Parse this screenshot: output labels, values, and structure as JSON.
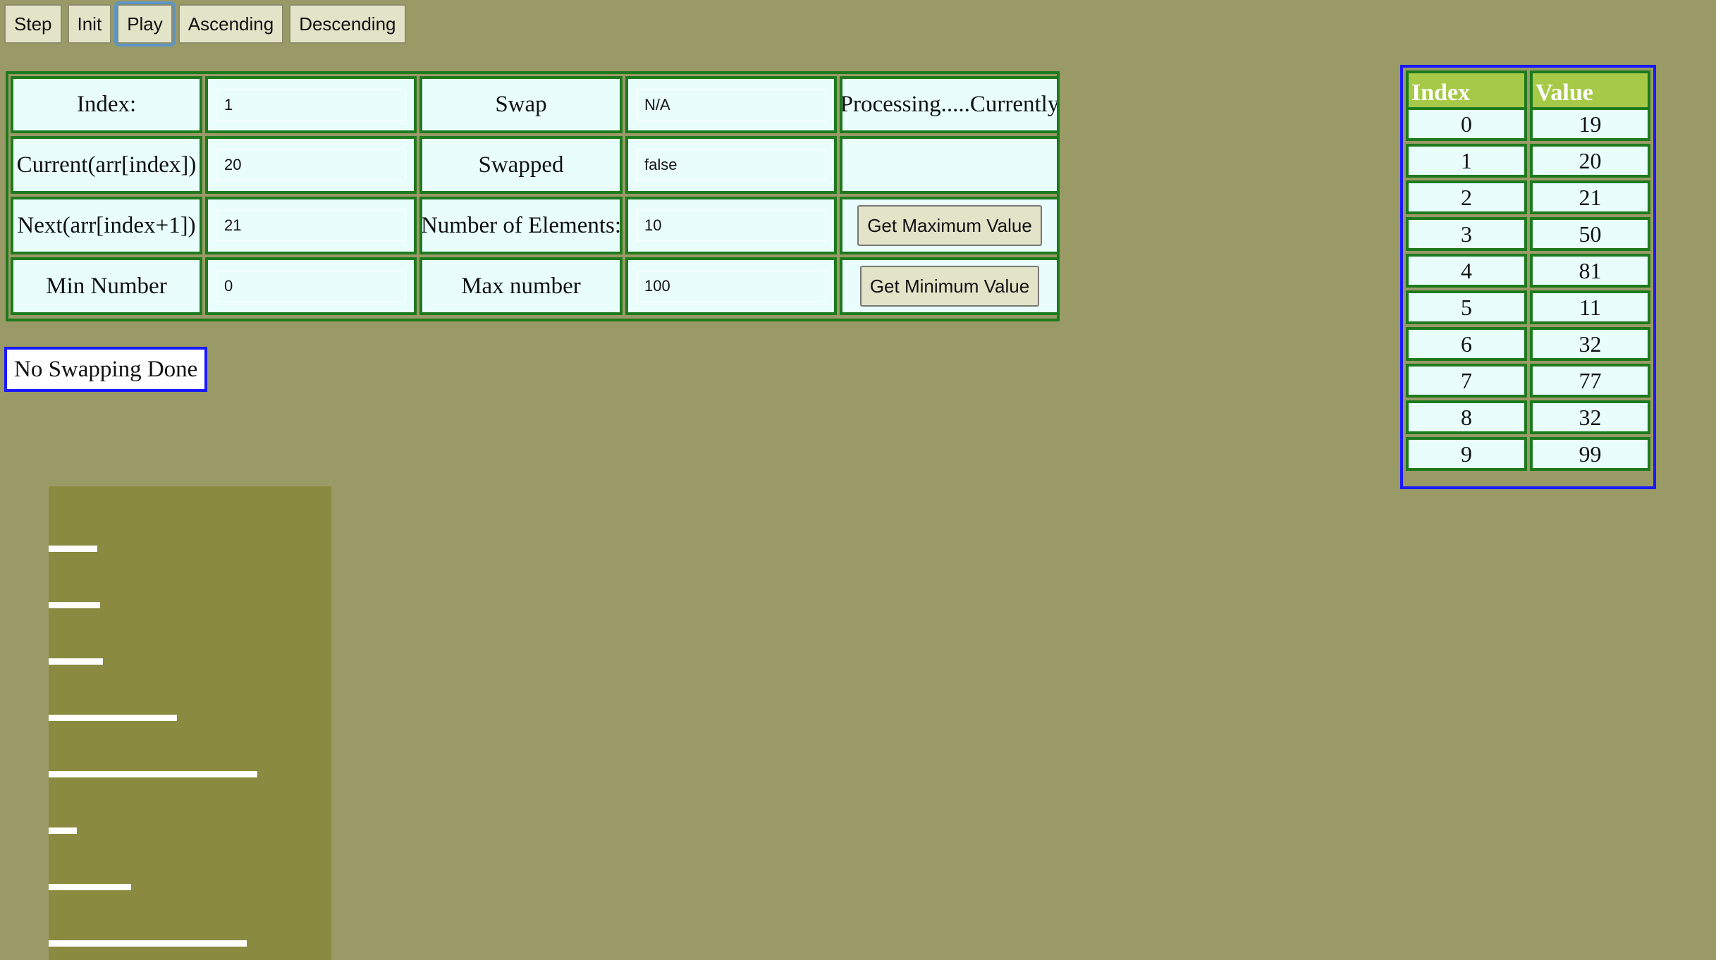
{
  "toolbar": {
    "step": "Step",
    "init": "Init",
    "play": "Play",
    "ascending": "Ascending",
    "descending": "Descending"
  },
  "panel": {
    "index_label": "Index:",
    "index_value": "1",
    "swap_label": "Swap",
    "swap_value": "N/A",
    "processing_label": "Processing.....Currently",
    "current_label": "Current(arr[index])",
    "current_value": "20",
    "swapped_label": "Swapped",
    "swapped_value": "false",
    "next_label": "Next(arr[index+1])",
    "next_value": "21",
    "num_elements_label": "Number of Elements:",
    "num_elements_value": "10",
    "get_max_button": "Get Maximum Value",
    "min_label": "Min Number",
    "min_value": "0",
    "max_label": "Max number",
    "max_value": "100",
    "get_min_button": "Get Minimum Value"
  },
  "status": "No Swapping Done",
  "value_table": {
    "headers": [
      "Index",
      "Value"
    ],
    "rows": [
      [
        "0",
        "19"
      ],
      [
        "1",
        "20"
      ],
      [
        "2",
        "21"
      ],
      [
        "3",
        "50"
      ],
      [
        "4",
        "81"
      ],
      [
        "5",
        "11"
      ],
      [
        "6",
        "32"
      ],
      [
        "7",
        "77"
      ],
      [
        "8",
        "32"
      ],
      [
        "9",
        "99"
      ]
    ]
  },
  "bars": {
    "max_value": 100,
    "values": [
      19,
      20,
      21,
      50,
      81,
      11,
      32,
      77
    ]
  },
  "colors": {
    "background": "#9a9a66",
    "cell_bg": "#e9fdfd",
    "border_green": "#1d7a1d",
    "border_blue": "#1a1aff",
    "header_green": "#a6c948",
    "bar_area": "#8a8a40",
    "bar": "#ffffff"
  }
}
